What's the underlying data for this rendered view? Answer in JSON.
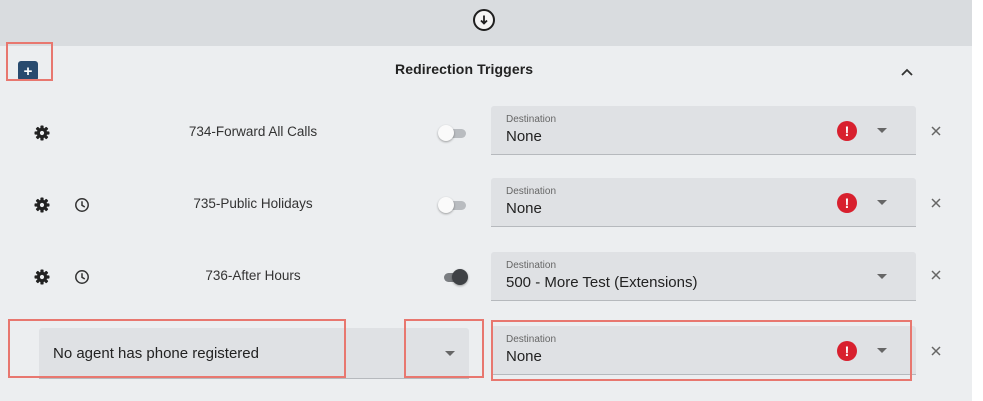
{
  "header": {
    "collapse_icon": "arrow-down-circle-icon"
  },
  "panel": {
    "title": "Redirection Triggers",
    "add_symbol": "+",
    "collapse_icon": "chevron-up-icon"
  },
  "triggers": [
    {
      "label": "734-Forward All Calls",
      "enabled": false,
      "has_schedule": false,
      "destination_label": "Destination",
      "destination_value": "None",
      "error": true
    },
    {
      "label": "735-Public Holidays",
      "enabled": false,
      "has_schedule": true,
      "destination_label": "Destination",
      "destination_value": "None",
      "error": true
    },
    {
      "label": "736-After Hours",
      "enabled": true,
      "has_schedule": true,
      "destination_label": "Destination",
      "destination_value": "500 - More Test (Extensions)",
      "error": false
    }
  ],
  "new_trigger": {
    "agent_value": "No agent has phone registered",
    "destination_label": "Destination",
    "destination_value": "None",
    "error": true
  },
  "error_symbol": "!",
  "colors": {
    "add_button": "#284a6e",
    "error": "#d8202e",
    "highlight": "#e8776f",
    "panel_bg": "#eceef0",
    "header_bg": "#d9dcdf"
  }
}
